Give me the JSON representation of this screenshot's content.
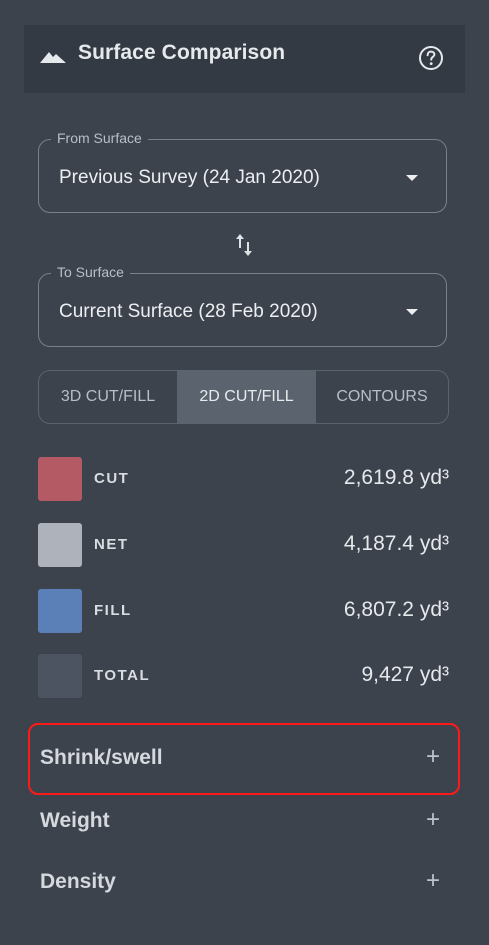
{
  "panel": {
    "title": "Surface Comparison",
    "title_icon": "mountain-icon",
    "help_icon": "help-circle-icon"
  },
  "from_surface": {
    "label": "From Surface",
    "value": "Previous Survey (24 Jan 2020)"
  },
  "swap_icon": "swap-vertical-icon",
  "to_surface": {
    "label": "To Surface",
    "value": "Current Surface (28 Feb 2020)"
  },
  "view_tabs": [
    {
      "label": "3D CUT/FILL",
      "selected": false
    },
    {
      "label": "2D CUT/FILL",
      "selected": true
    },
    {
      "label": "CONTOURS",
      "selected": false
    }
  ],
  "volumes": [
    {
      "label": "CUT",
      "value": "2,619.8 yd³",
      "color": "#b45a64"
    },
    {
      "label": "NET",
      "value": "4,187.4 yd³",
      "color": "#aeb3bb"
    },
    {
      "label": "FILL",
      "value": "6,807.2 yd³",
      "color": "#5b80b8"
    },
    {
      "label": "TOTAL",
      "value": "9,427 yd³",
      "color": "#4c5461"
    }
  ],
  "sections": [
    {
      "label": "Shrink/swell",
      "expand": "+",
      "highlighted": true
    },
    {
      "label": "Weight",
      "expand": "+",
      "highlighted": false
    },
    {
      "label": "Density",
      "expand": "+",
      "highlighted": false
    }
  ]
}
